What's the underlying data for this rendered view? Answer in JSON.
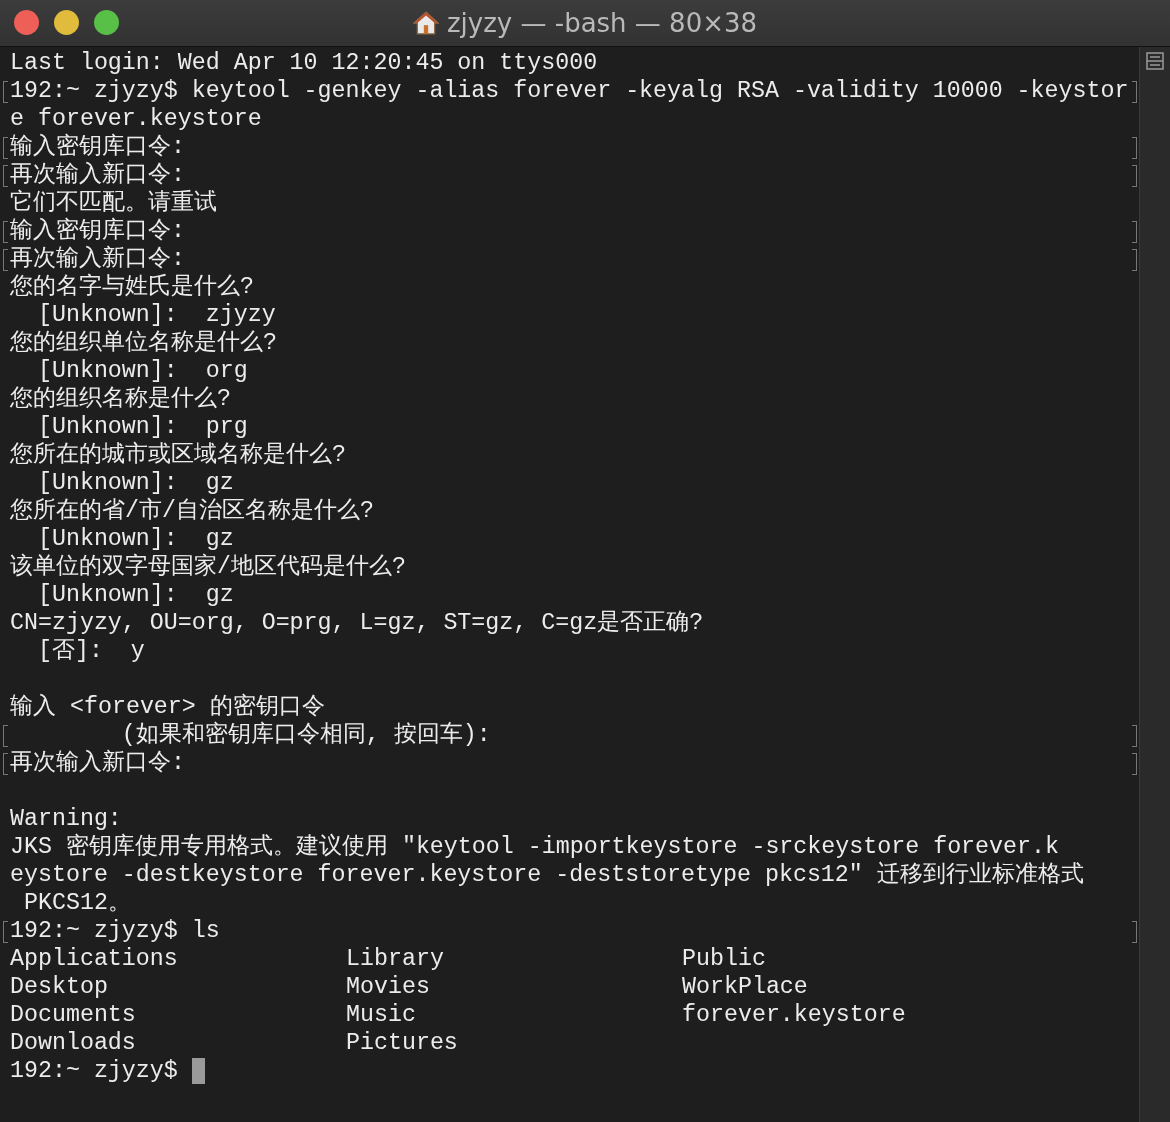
{
  "window": {
    "title": "zjyzy — -bash — 80×38"
  },
  "lines": [
    {
      "kind": "text",
      "text": "Last login: Wed Apr 10 12:20:45 on ttys000",
      "marked": false
    },
    {
      "kind": "text",
      "text": "192:~ zjyzy$ keytool -genkey -alias forever -keyalg RSA -validity 10000 -keystor",
      "marked": true
    },
    {
      "kind": "text",
      "text": "e forever.keystore",
      "marked": false
    },
    {
      "kind": "text",
      "text": "输入密钥库口令:",
      "marked": true
    },
    {
      "kind": "text",
      "text": "再次输入新口令:",
      "marked": true
    },
    {
      "kind": "text",
      "text": "它们不匹配。请重试",
      "marked": false
    },
    {
      "kind": "text",
      "text": "输入密钥库口令:",
      "marked": true
    },
    {
      "kind": "text",
      "text": "再次输入新口令:",
      "marked": true
    },
    {
      "kind": "text",
      "text": "您的名字与姓氏是什么?",
      "marked": false
    },
    {
      "kind": "text",
      "text": "  [Unknown]:  zjyzy",
      "marked": false
    },
    {
      "kind": "text",
      "text": "您的组织单位名称是什么?",
      "marked": false
    },
    {
      "kind": "text",
      "text": "  [Unknown]:  org",
      "marked": false
    },
    {
      "kind": "text",
      "text": "您的组织名称是什么?",
      "marked": false
    },
    {
      "kind": "text",
      "text": "  [Unknown]:  prg",
      "marked": false
    },
    {
      "kind": "text",
      "text": "您所在的城市或区域名称是什么?",
      "marked": false
    },
    {
      "kind": "text",
      "text": "  [Unknown]:  gz",
      "marked": false
    },
    {
      "kind": "text",
      "text": "您所在的省/市/自治区名称是什么?",
      "marked": false
    },
    {
      "kind": "text",
      "text": "  [Unknown]:  gz",
      "marked": false
    },
    {
      "kind": "text",
      "text": "该单位的双字母国家/地区代码是什么?",
      "marked": false
    },
    {
      "kind": "text",
      "text": "  [Unknown]:  gz",
      "marked": false
    },
    {
      "kind": "text",
      "text": "CN=zjyzy, OU=org, O=prg, L=gz, ST=gz, C=gz是否正确?",
      "marked": false
    },
    {
      "kind": "text",
      "text": "  [否]:  y",
      "marked": false
    },
    {
      "kind": "blank"
    },
    {
      "kind": "text",
      "text": "输入 <forever> 的密钥口令",
      "marked": false
    },
    {
      "kind": "text",
      "text": "        (如果和密钥库口令相同, 按回车):",
      "marked": true
    },
    {
      "kind": "text",
      "text": "再次输入新口令:",
      "marked": true
    },
    {
      "kind": "blank"
    },
    {
      "kind": "text",
      "text": "Warning:",
      "marked": false
    },
    {
      "kind": "text",
      "text": "JKS 密钥库使用专用格式。建议使用 \"keytool -importkeystore -srckeystore forever.k",
      "marked": false
    },
    {
      "kind": "text",
      "text": "eystore -destkeystore forever.keystore -deststoretype pkcs12\" 迁移到行业标准格式",
      "marked": false
    },
    {
      "kind": "text",
      "text": " PKCS12。",
      "marked": false
    },
    {
      "kind": "text",
      "text": "192:~ zjyzy$ ls",
      "marked": true
    },
    {
      "kind": "listing",
      "cells": [
        "Applications",
        "Library",
        "Public"
      ],
      "marked": false
    },
    {
      "kind": "listing",
      "cells": [
        "Desktop",
        "Movies",
        "WorkPlace"
      ],
      "marked": false
    },
    {
      "kind": "listing",
      "cells": [
        "Documents",
        "Music",
        "forever.keystore"
      ],
      "marked": false
    },
    {
      "kind": "listing",
      "cells": [
        "Downloads",
        "Pictures"
      ],
      "marked": false
    },
    {
      "kind": "prompt",
      "text": "192:~ zjyzy$ ",
      "marked": false
    }
  ]
}
